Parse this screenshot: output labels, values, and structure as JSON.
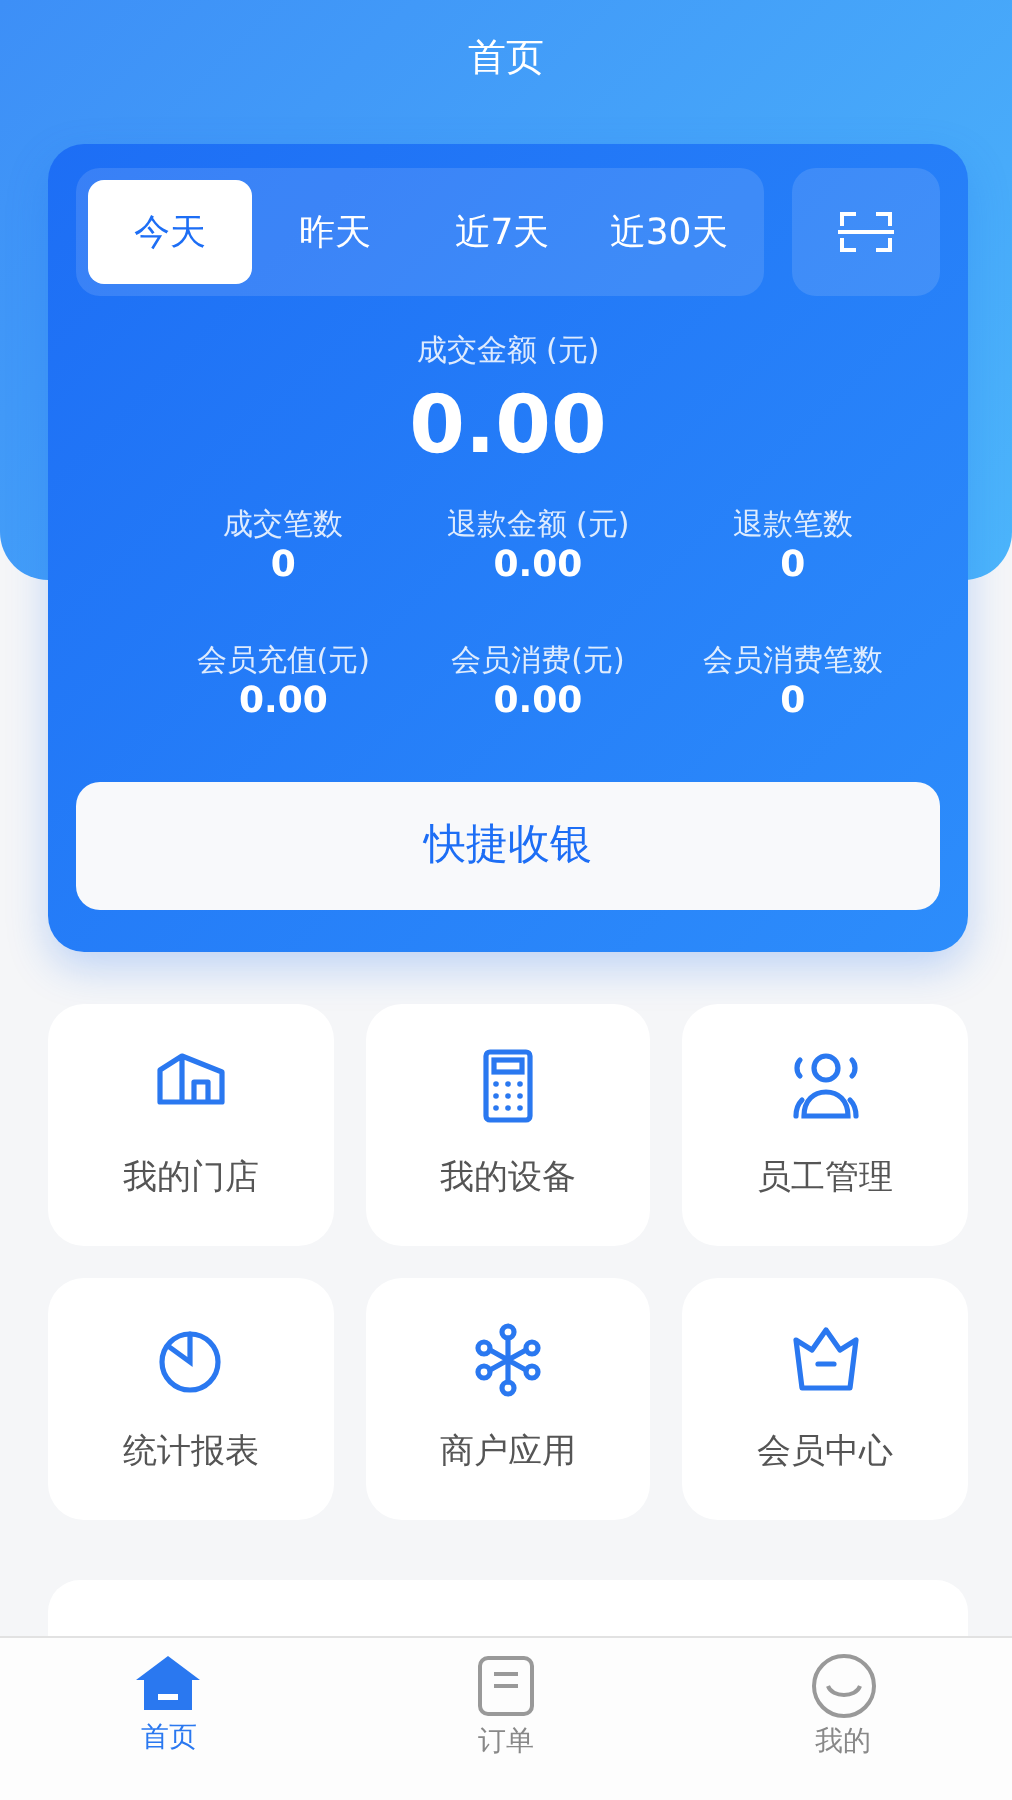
{
  "header": {
    "title": "首页"
  },
  "period_tabs": [
    {
      "label": "今天",
      "selected": true
    },
    {
      "label": "昨天",
      "selected": false
    },
    {
      "label": "近7天",
      "selected": false
    },
    {
      "label": "近30天",
      "selected": false
    }
  ],
  "main_stat": {
    "label": "成交金额 (元)",
    "value": "0.00"
  },
  "stats": [
    {
      "label": "成交笔数",
      "value": "0"
    },
    {
      "label": "退款金额 (元)",
      "value": "0.00"
    },
    {
      "label": "退款笔数",
      "value": "0"
    },
    {
      "label": "会员充值(元)",
      "value": "0.00"
    },
    {
      "label": "会员消费(元)",
      "value": "0.00"
    },
    {
      "label": "会员消费笔数",
      "value": "0"
    }
  ],
  "quick_button": "快捷收银",
  "menu": [
    {
      "label": "我的门店",
      "kind": "store"
    },
    {
      "label": "我的设备",
      "kind": "device"
    },
    {
      "label": "员工管理",
      "kind": "staff"
    },
    {
      "label": "统计报表",
      "kind": "report"
    },
    {
      "label": "商户应用",
      "kind": "apps"
    },
    {
      "label": "会员中心",
      "kind": "member"
    }
  ],
  "tab_bar": [
    {
      "label": "首页",
      "kind": "home",
      "selected": true
    },
    {
      "label": "订单",
      "kind": "order",
      "selected": false
    },
    {
      "label": "我的",
      "kind": "me",
      "selected": false
    }
  ]
}
